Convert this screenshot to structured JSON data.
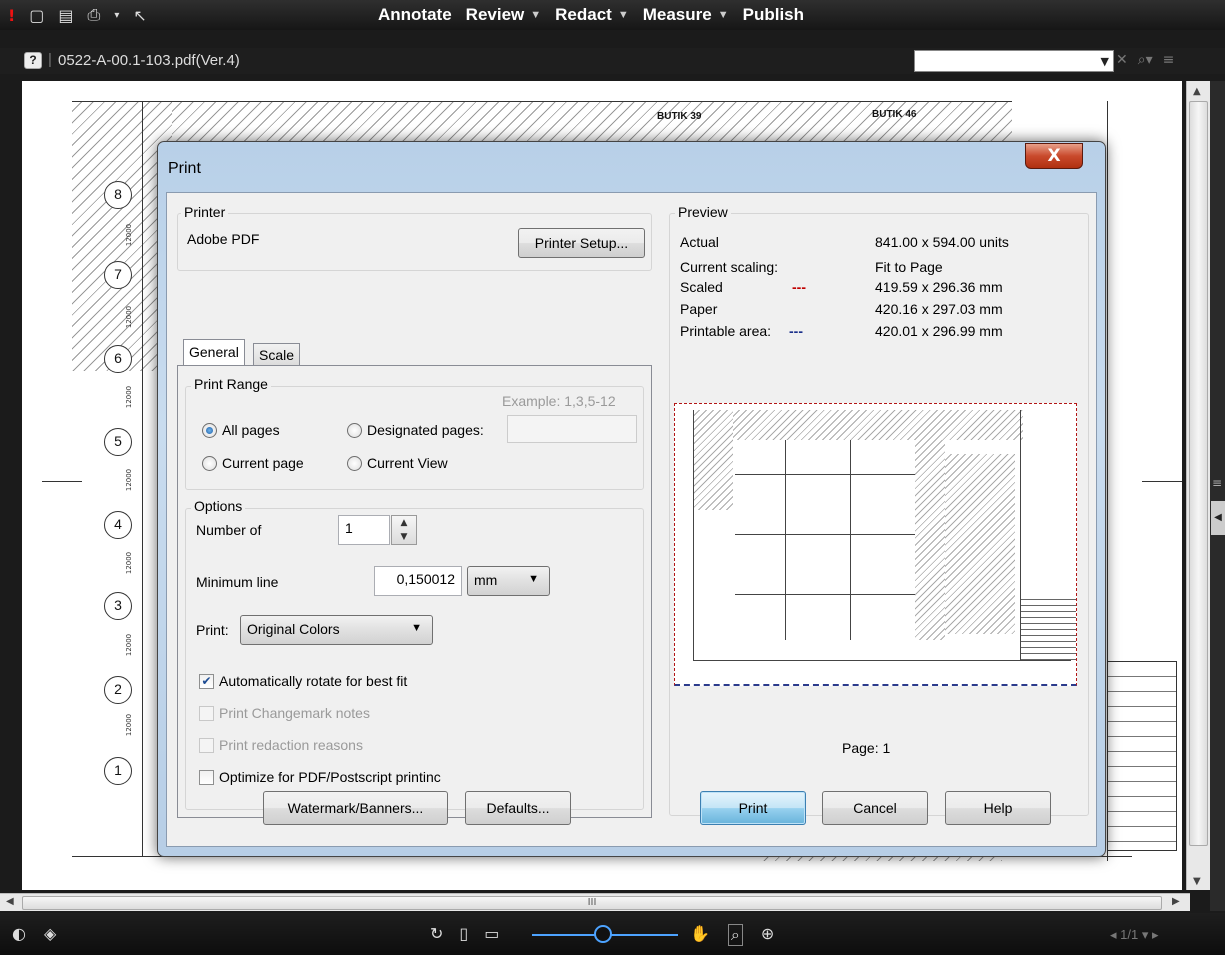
{
  "toolbar": {
    "menu": [
      {
        "label": "Annotate",
        "has_dropdown": false
      },
      {
        "label": "Review",
        "has_dropdown": true
      },
      {
        "label": "Redact",
        "has_dropdown": true
      },
      {
        "label": "Measure",
        "has_dropdown": true
      },
      {
        "label": "Publish",
        "has_dropdown": false
      }
    ]
  },
  "document": {
    "help_label": "?",
    "file_name": "0522-A-00.1-103.pdf(Ver.4)",
    "search_value": ""
  },
  "drawing": {
    "grid_labels": [
      "8",
      "7",
      "6",
      "5",
      "4",
      "3",
      "2",
      "1"
    ],
    "shop_labels": [
      "BUTIK 39",
      "BUTIK 46"
    ],
    "dimension": "12000"
  },
  "print_dialog": {
    "title": "Print",
    "close_label": "X",
    "printer": {
      "group_label": "Printer",
      "name": "Adobe PDF",
      "setup_button": "Printer Setup..."
    },
    "tabs": [
      "General",
      "Scale"
    ],
    "print_range": {
      "group_label": "Print Range",
      "example": "Example: 1,3,5-12",
      "all_pages": "All pages",
      "designated_pages": "Designated pages:",
      "designated_value": "",
      "current_page": "Current page",
      "current_view": "Current View",
      "selected": "All pages"
    },
    "options": {
      "group_label": "Options",
      "number_of_label": "Number of",
      "number_of_value": "1",
      "min_line_label": "Minimum line",
      "min_line_value": "0,150012",
      "min_line_unit": "mm",
      "print_label": "Print:",
      "print_mode": "Original Colors",
      "auto_rotate": "Automatically rotate for best fit",
      "auto_rotate_checked": true,
      "changemark_notes": "Print Changemark notes",
      "redaction_reasons": "Print redaction reasons",
      "optimize": "Optimize for PDF/Postscript printinc",
      "optimize_checked": false
    },
    "preview": {
      "group_label": "Preview",
      "rows": [
        {
          "label": "Actual",
          "marker": "",
          "value": "841.00 x 594.00 units"
        },
        {
          "label": "Current scaling:",
          "marker": "",
          "value": "Fit to Page"
        },
        {
          "label": "Scaled",
          "marker": "---",
          "value": "419.59 x 296.36 mm"
        },
        {
          "label": "Paper",
          "marker": "",
          "value": "420.16 x 297.03 mm"
        },
        {
          "label": "Printable area:",
          "marker": "---",
          "value": "420.01 x 296.99 mm"
        }
      ],
      "page_label": "Page: 1"
    },
    "buttons": {
      "watermark": "Watermark/Banners...",
      "defaults": "Defaults...",
      "print": "Print",
      "cancel": "Cancel",
      "help": "Help"
    }
  },
  "bottombar": {
    "page_indicator": "1/1",
    "scroll_grip": "III"
  },
  "colors": {
    "scaled_marker": "#c00000",
    "printable_marker": "#1a2f8a",
    "dialog_frame": "#b8d0e8",
    "close_button": "#c94a2c",
    "zoom_accent": "#4da3ff"
  }
}
